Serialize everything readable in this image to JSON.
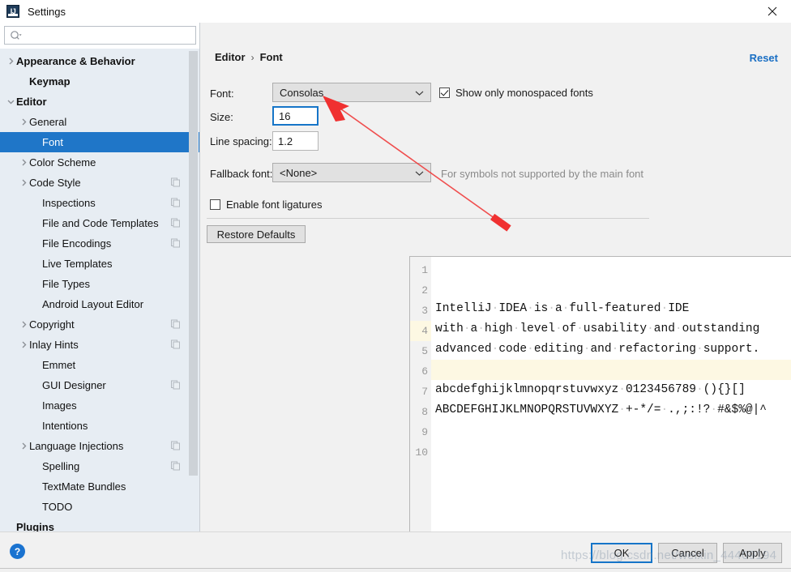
{
  "window": {
    "title": "Settings",
    "app_icon": "intellij-idea-icon",
    "close_icon": "close-icon"
  },
  "search": {
    "value": "",
    "placeholder": "",
    "icon": "search-icon"
  },
  "sidebar": {
    "items": [
      {
        "label": "Appearance & Behavior",
        "indent": 0,
        "expandable": true,
        "expanded": false,
        "bold": true,
        "selected": false,
        "copyable": false
      },
      {
        "label": "Keymap",
        "indent": 1,
        "expandable": false,
        "expanded": false,
        "bold": true,
        "selected": false,
        "copyable": false
      },
      {
        "label": "Editor",
        "indent": 0,
        "expandable": true,
        "expanded": true,
        "bold": true,
        "selected": false,
        "copyable": false
      },
      {
        "label": "General",
        "indent": 1,
        "expandable": true,
        "expanded": false,
        "bold": false,
        "selected": false,
        "copyable": false
      },
      {
        "label": "Font",
        "indent": 2,
        "expandable": false,
        "expanded": false,
        "bold": false,
        "selected": true,
        "copyable": false
      },
      {
        "label": "Color Scheme",
        "indent": 1,
        "expandable": true,
        "expanded": false,
        "bold": false,
        "selected": false,
        "copyable": false
      },
      {
        "label": "Code Style",
        "indent": 1,
        "expandable": true,
        "expanded": false,
        "bold": false,
        "selected": false,
        "copyable": true
      },
      {
        "label": "Inspections",
        "indent": 2,
        "expandable": false,
        "expanded": false,
        "bold": false,
        "selected": false,
        "copyable": true
      },
      {
        "label": "File and Code Templates",
        "indent": 2,
        "expandable": false,
        "expanded": false,
        "bold": false,
        "selected": false,
        "copyable": true
      },
      {
        "label": "File Encodings",
        "indent": 2,
        "expandable": false,
        "expanded": false,
        "bold": false,
        "selected": false,
        "copyable": true
      },
      {
        "label": "Live Templates",
        "indent": 2,
        "expandable": false,
        "expanded": false,
        "bold": false,
        "selected": false,
        "copyable": false
      },
      {
        "label": "File Types",
        "indent": 2,
        "expandable": false,
        "expanded": false,
        "bold": false,
        "selected": false,
        "copyable": false
      },
      {
        "label": "Android Layout Editor",
        "indent": 2,
        "expandable": false,
        "expanded": false,
        "bold": false,
        "selected": false,
        "copyable": false
      },
      {
        "label": "Copyright",
        "indent": 1,
        "expandable": true,
        "expanded": false,
        "bold": false,
        "selected": false,
        "copyable": true
      },
      {
        "label": "Inlay Hints",
        "indent": 1,
        "expandable": true,
        "expanded": false,
        "bold": false,
        "selected": false,
        "copyable": true
      },
      {
        "label": "Emmet",
        "indent": 2,
        "expandable": false,
        "expanded": false,
        "bold": false,
        "selected": false,
        "copyable": false
      },
      {
        "label": "GUI Designer",
        "indent": 2,
        "expandable": false,
        "expanded": false,
        "bold": false,
        "selected": false,
        "copyable": true
      },
      {
        "label": "Images",
        "indent": 2,
        "expandable": false,
        "expanded": false,
        "bold": false,
        "selected": false,
        "copyable": false
      },
      {
        "label": "Intentions",
        "indent": 2,
        "expandable": false,
        "expanded": false,
        "bold": false,
        "selected": false,
        "copyable": false
      },
      {
        "label": "Language Injections",
        "indent": 1,
        "expandable": true,
        "expanded": false,
        "bold": false,
        "selected": false,
        "copyable": true
      },
      {
        "label": "Spelling",
        "indent": 2,
        "expandable": false,
        "expanded": false,
        "bold": false,
        "selected": false,
        "copyable": true
      },
      {
        "label": "TextMate Bundles",
        "indent": 2,
        "expandable": false,
        "expanded": false,
        "bold": false,
        "selected": false,
        "copyable": false
      },
      {
        "label": "TODO",
        "indent": 2,
        "expandable": false,
        "expanded": false,
        "bold": false,
        "selected": false,
        "copyable": false
      },
      {
        "label": "Plugins",
        "indent": 0,
        "expandable": false,
        "expanded": false,
        "bold": true,
        "selected": false,
        "copyable": false
      }
    ]
  },
  "breadcrumb": {
    "parent": "Editor",
    "separator": "›",
    "current": "Font"
  },
  "reset_label": "Reset",
  "form": {
    "font_label": "Font:",
    "font_value": "Consolas",
    "size_label": "Size:",
    "size_value": "16",
    "line_spacing_label": "Line spacing:",
    "line_spacing_value": "1.2",
    "fallback_label": "Fallback font:",
    "fallback_value": "<None>",
    "fallback_hint": "For symbols not supported by the main font",
    "show_monospaced_label": "Show only monospaced fonts",
    "show_monospaced_checked": true,
    "ligatures_label": "Enable font ligatures",
    "ligatures_checked": false,
    "restore_defaults_label": "Restore Defaults"
  },
  "preview": {
    "line_numbers": [
      "1",
      "2",
      "3",
      "4",
      "5",
      "6",
      "7",
      "8",
      "9",
      "10"
    ],
    "highlighted_line": 4,
    "lines": [
      "IntelliJ·IDEA·is·a·full-featured·IDE",
      "with·a·high·level·of·usability·and·outstanding",
      "advanced·code·editing·and·refactoring·support.",
      "",
      "abcdefghijklmnopqrstuvwxyz·0123456789·(){}[]",
      "ABCDEFGHIJKLMNOPQRSTUVWXYZ·+-*/=·.,;:!?·#&$%@|^",
      "",
      "",
      "",
      ""
    ],
    "inspection_icon": "inspection-ok-check-icon"
  },
  "footer": {
    "help_icon": "help-question-icon",
    "ok_label": "OK",
    "cancel_label": "Cancel",
    "apply_label": "Apply"
  },
  "annotation": {
    "type": "red-arrow",
    "color": "#f03131",
    "points_to": "size-input"
  },
  "watermark": {
    "text": "https://blog.csdn.net/weixin_44409194"
  },
  "colors": {
    "accent": "#1f76c8",
    "link": "#1a6fc4",
    "sidebar_bg": "#e7edf3",
    "panel_bg": "#f1f1f1",
    "highlight_line": "#fdf8e3",
    "annotation_red": "#f03131"
  }
}
